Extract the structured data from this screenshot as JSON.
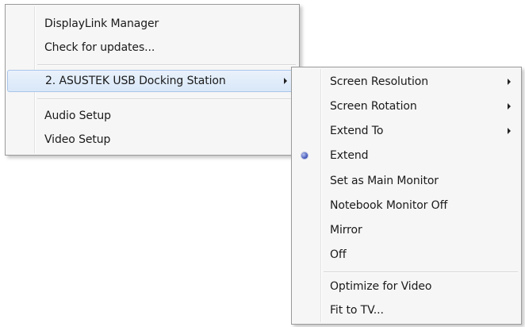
{
  "main_menu": {
    "items": [
      {
        "label": "DisplayLink Manager"
      },
      {
        "label": "Check for updates..."
      },
      {
        "label": "2. ASUSTEK USB Docking Station"
      },
      {
        "label": "Audio Setup"
      },
      {
        "label": "Video Setup"
      }
    ]
  },
  "sub_menu": {
    "items": [
      {
        "label": "Screen Resolution"
      },
      {
        "label": "Screen Rotation"
      },
      {
        "label": "Extend To"
      },
      {
        "label": "Extend"
      },
      {
        "label": "Set as Main Monitor"
      },
      {
        "label": "Notebook Monitor Off"
      },
      {
        "label": "Mirror"
      },
      {
        "label": "Off"
      },
      {
        "label": "Optimize for Video"
      },
      {
        "label": "Fit to TV..."
      }
    ]
  },
  "icons": {
    "submenu_arrow": "chevron-right-icon",
    "selected_indicator": "radio-dot-icon"
  },
  "colors": {
    "menu_background": "#f6f6f6",
    "menu_border": "#9a9a9a",
    "highlight_border": "#a9c6ea",
    "highlight_fill": "#dce9f9",
    "radio_dot": "#3a4fb5"
  }
}
